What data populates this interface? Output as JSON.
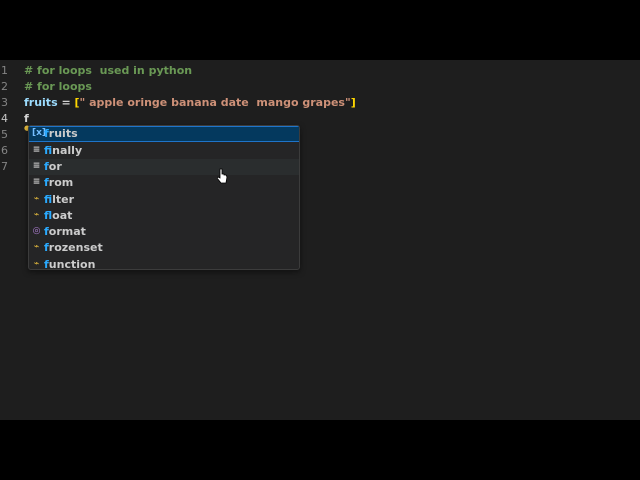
{
  "editor": {
    "lines": [
      {
        "number": "1",
        "parts": [
          {
            "text": "# for loops  used in python",
            "kind": "comment"
          }
        ]
      },
      {
        "number": "2",
        "parts": [
          {
            "text": "# for loops",
            "kind": "comment"
          }
        ]
      },
      {
        "number": "3",
        "parts": [
          {
            "text": "fruits",
            "kind": "var"
          },
          {
            "text": " = ",
            "kind": "op"
          },
          {
            "text": "[",
            "kind": "bracket"
          },
          {
            "text": "\" apple oringe banana date  mango grapes\"",
            "kind": "str"
          },
          {
            "text": "]",
            "kind": "bracket"
          }
        ]
      },
      {
        "number": "4",
        "parts": [
          {
            "text": "f",
            "kind": "typed"
          }
        ]
      },
      {
        "number": "5",
        "parts": []
      },
      {
        "number": "6",
        "parts": []
      },
      {
        "number": "7",
        "parts": []
      }
    ]
  },
  "suggest": {
    "typed_prefix": "f",
    "items": [
      {
        "label_match": "f",
        "label_rest": "ruits",
        "icon": "variable-icon",
        "glyph": "[x]",
        "state": "selected"
      },
      {
        "label_match": "f",
        "label_rest": "inally",
        "icon": "keyword-icon",
        "glyph": "≡",
        "state": ""
      },
      {
        "label_match": "f",
        "label_rest": "or",
        "icon": "keyword-icon",
        "glyph": "≡",
        "state": "hovered"
      },
      {
        "label_match": "f",
        "label_rest": "rom",
        "icon": "keyword-icon",
        "glyph": "≡",
        "state": ""
      },
      {
        "label_match": "f",
        "label_rest": "ilter",
        "icon": "function-icon",
        "glyph": "⌁",
        "state": ""
      },
      {
        "label_match": "f",
        "label_rest": "loat",
        "icon": "function-icon",
        "glyph": "⌁",
        "state": ""
      },
      {
        "label_match": "f",
        "label_rest": "ormat",
        "icon": "method-icon",
        "glyph": "◎",
        "state": ""
      },
      {
        "label_match": "f",
        "label_rest": "rozenset",
        "icon": "function-icon",
        "glyph": "⌁",
        "state": ""
      },
      {
        "label_match": "f",
        "label_rest": "unction",
        "icon": "function-icon",
        "glyph": "⌁",
        "state": ""
      }
    ]
  },
  "colors": {
    "background": "#1e1e1e",
    "comment": "#6a9955",
    "variable": "#9cdcfe",
    "string": "#ce9178",
    "selection": "#04395e",
    "match": "#2aaaff"
  }
}
